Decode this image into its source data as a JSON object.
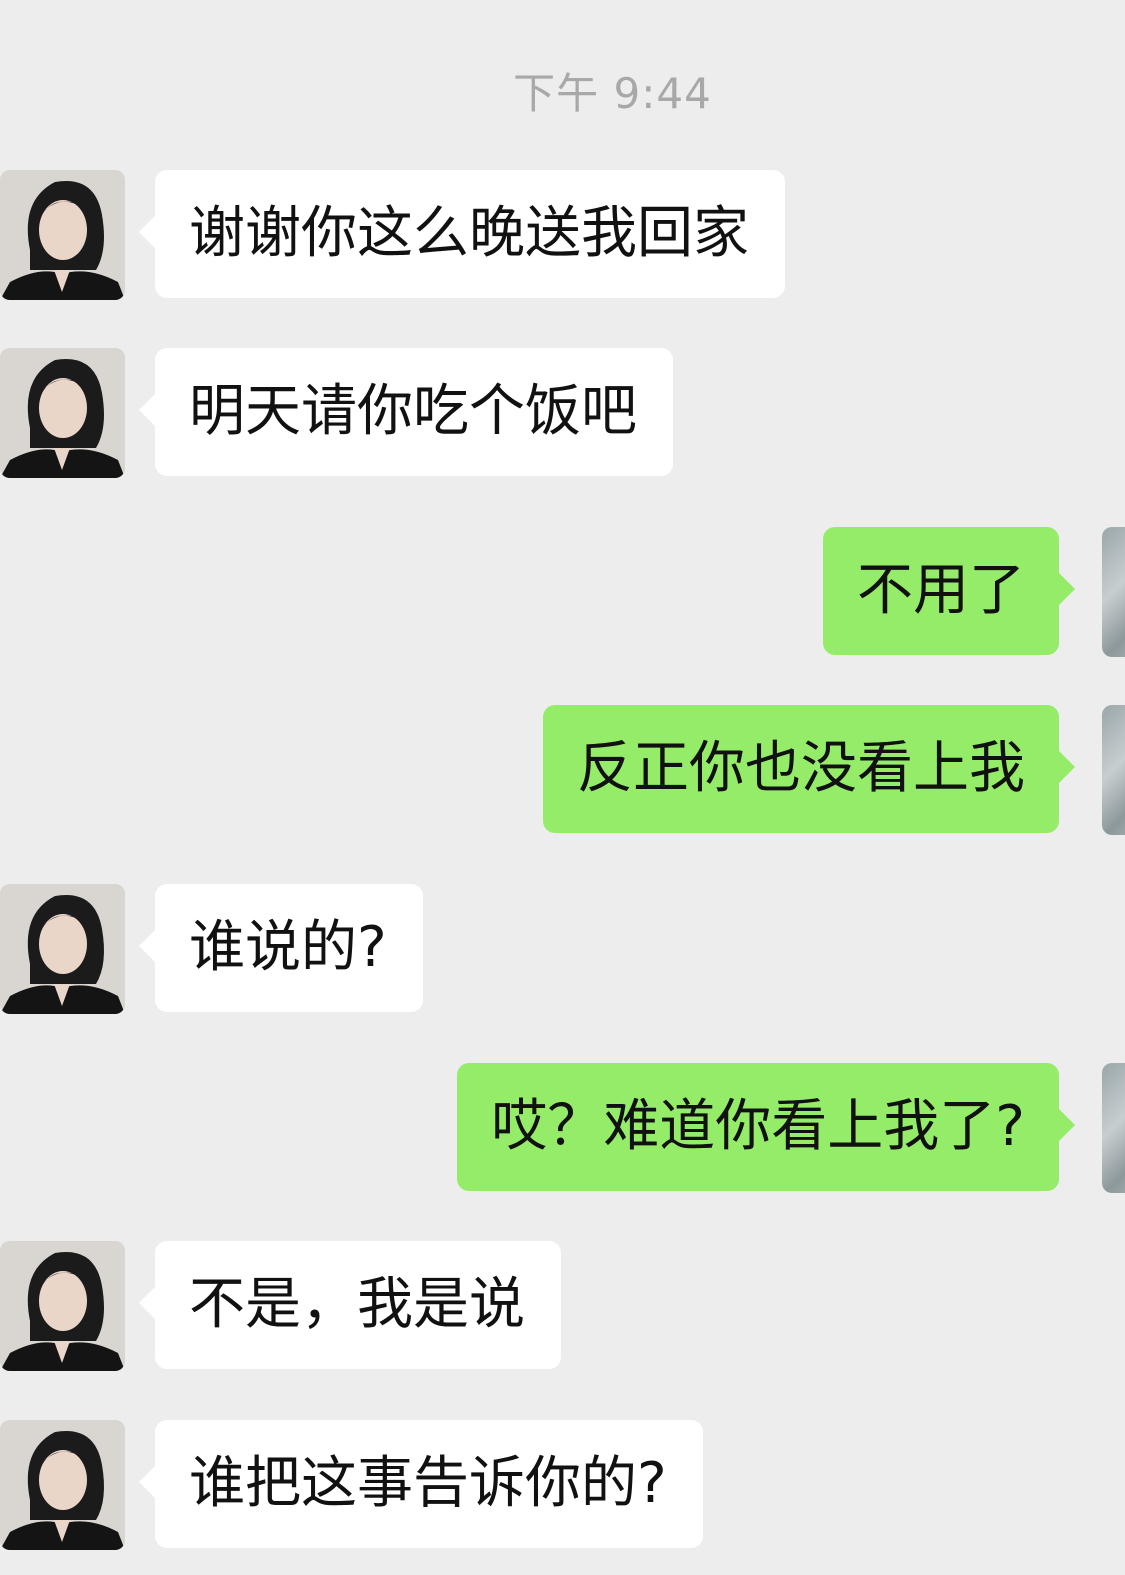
{
  "chat": {
    "timestamp": "下午 9:44",
    "messages": [
      {
        "sender": "other",
        "text": "谢谢你这么晚送我回家"
      },
      {
        "sender": "other",
        "text": "明天请你吃个饭吧"
      },
      {
        "sender": "me",
        "text": "不用了"
      },
      {
        "sender": "me",
        "text": "反正你也没看上我"
      },
      {
        "sender": "other",
        "text": "谁说的?"
      },
      {
        "sender": "me",
        "text": "哎？难道你看上我了?"
      },
      {
        "sender": "other",
        "text": "不是，我是说"
      },
      {
        "sender": "other",
        "text": "谁把这事告诉你的?"
      }
    ]
  },
  "colors": {
    "background": "#ededed",
    "incoming_bubble": "#ffffff",
    "outgoing_bubble": "#95ec69",
    "timestamp_text": "#a8a8a8"
  }
}
